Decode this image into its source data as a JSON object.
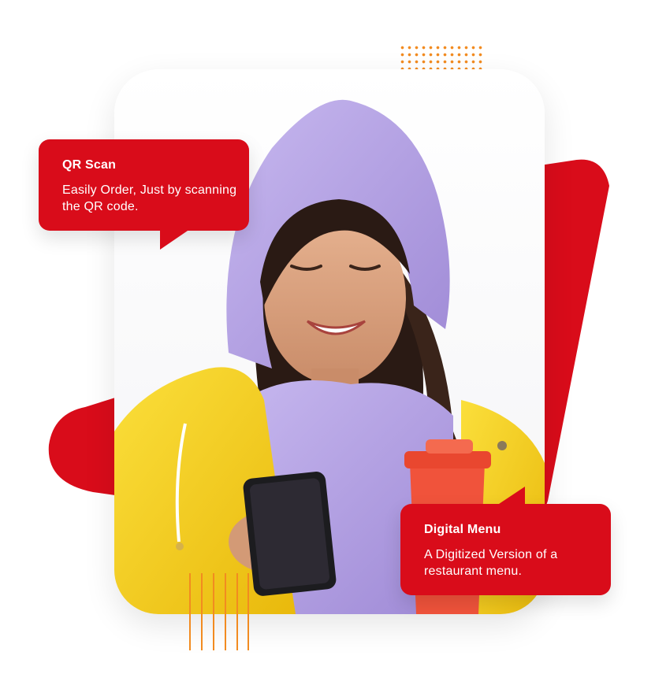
{
  "colors": {
    "brand_red": "#d90c1a",
    "accent_orange": "#f28b20",
    "hoodie_lavender": "#b7a6e6",
    "jacket_yellow": "#f5cf1d",
    "cup_orange": "#f0533b"
  },
  "bubbles": {
    "qr_scan": {
      "title": "QR Scan",
      "text": "Easily Order, Just by scanning the QR code."
    },
    "digital_menu": {
      "title": "Digital Menu",
      "text": "A Digitized Version of a restaurant menu."
    }
  },
  "decorations": [
    "dot-grid",
    "red-triangle-shapes",
    "orange-vertical-lines"
  ],
  "photo_subject": "woman-in-hoodie-with-phone-and-coffee-cup"
}
